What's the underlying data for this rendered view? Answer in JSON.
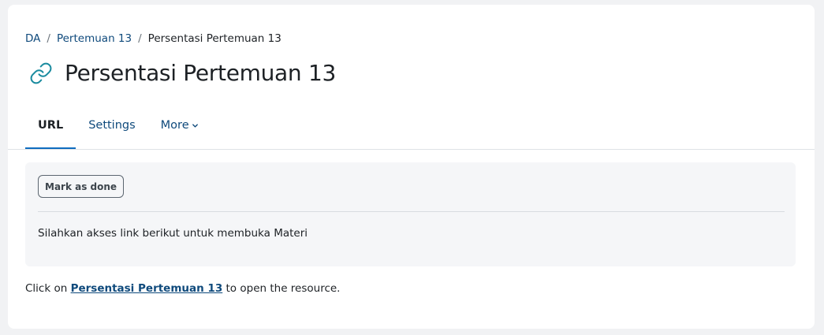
{
  "breadcrumb": {
    "items": [
      "DA",
      "Pertemuan 13"
    ],
    "separator": "/",
    "current": "Persentasi Pertemuan 13"
  },
  "page": {
    "title": "Persentasi Pertemuan 13",
    "icon": "link-icon",
    "icon_color": "#1a8b9f"
  },
  "tabs": [
    {
      "label": "URL",
      "active": true
    },
    {
      "label": "Settings",
      "active": false
    },
    {
      "label": "More",
      "active": false
    }
  ],
  "activity": {
    "mark_done_label": "Mark as done",
    "description": "Silahkan akses link berikut untuk membuka Materi"
  },
  "resource": {
    "prefix": "Click on",
    "link_text": "Persentasi Pertemuan 13",
    "suffix": "to open the resource."
  },
  "colors": {
    "link": "#0f4a7c",
    "active_tab_underline": "#0f6cbf",
    "page_background": "#f1f2f4",
    "box_background": "#f5f6f8"
  }
}
